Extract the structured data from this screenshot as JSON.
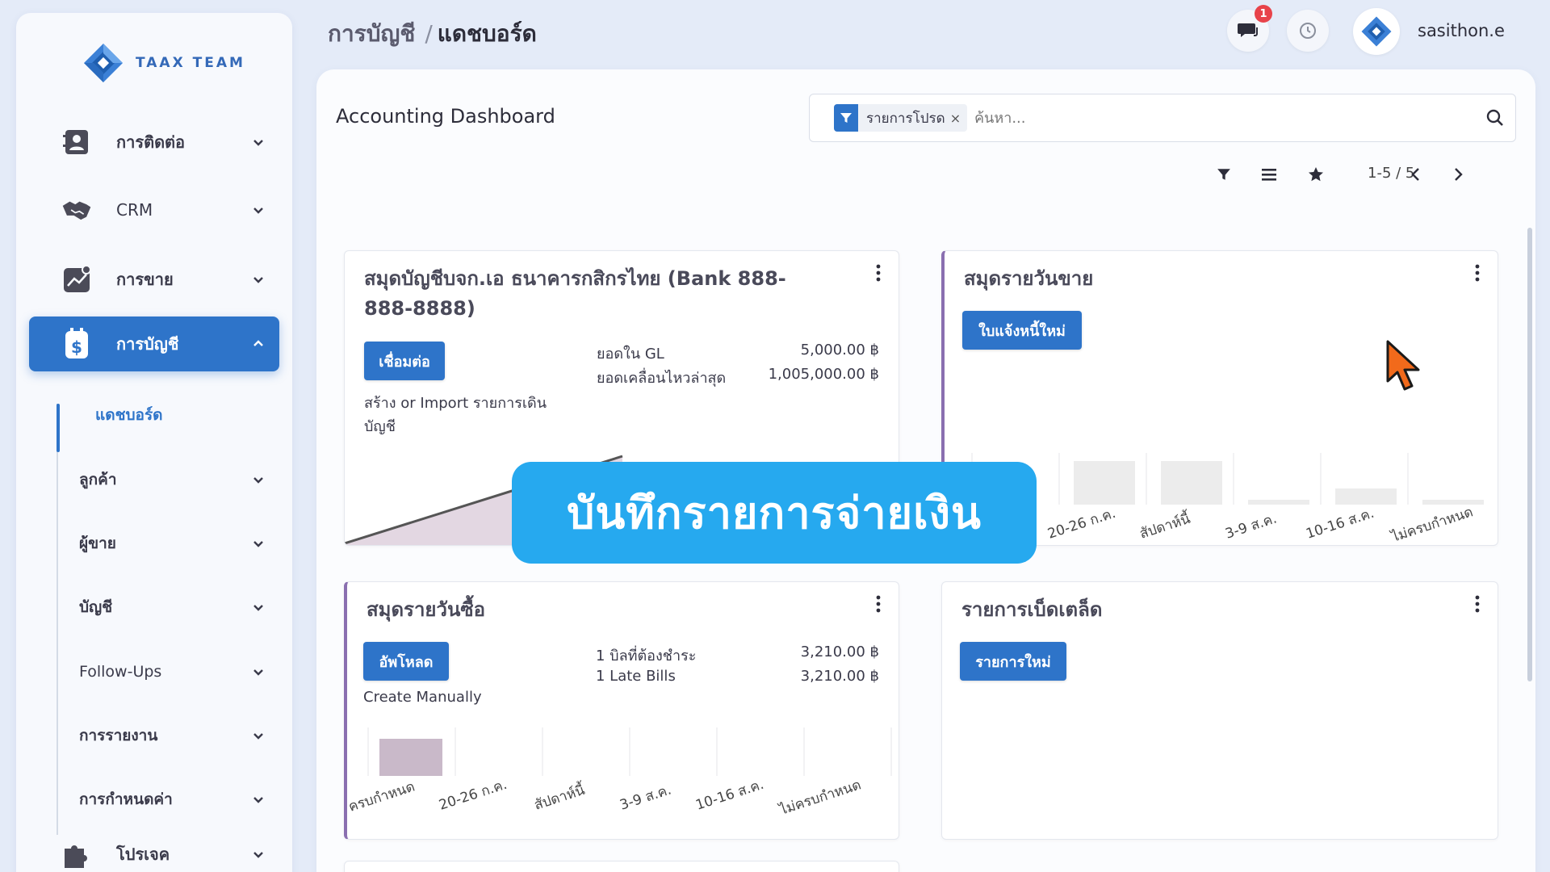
{
  "brand": {
    "name": "TAAX TEAM",
    "color": "#3469b8"
  },
  "sidebar": {
    "items": [
      {
        "label": "การติดต่อ",
        "icon": "contact-card-icon"
      },
      {
        "label": "CRM",
        "icon": "handshake-icon"
      },
      {
        "label": "การขาย",
        "icon": "sales-chart-icon"
      },
      {
        "label": "การบัญชี",
        "icon": "accounting-dollar-icon",
        "active": true
      }
    ],
    "subitems": [
      {
        "label": "แดชบอร์ด",
        "current": true
      },
      {
        "label": "ลูกค้า"
      },
      {
        "label": "ผู้ขาย"
      },
      {
        "label": "บัญชี"
      },
      {
        "label": "Follow-Ups"
      },
      {
        "label": "การรายงาน"
      },
      {
        "label": "การกำหนดค่า"
      }
    ],
    "bottom_item": {
      "label": "โปรเจค",
      "icon": "puzzle-icon"
    }
  },
  "header": {
    "breadcrumb_parent": "การบัญชี",
    "breadcrumb_sep": "/",
    "breadcrumb_current": "แดชบอร์ด",
    "chat_badge": "1",
    "username": "sasithon.e"
  },
  "main": {
    "title": "Accounting Dashboard",
    "search": {
      "facet": "รายการโปรด",
      "facet_close": "×",
      "placeholder": "ค้นหา..."
    },
    "pager": "1-5 / 5"
  },
  "cards": {
    "bank": {
      "title": "สมุดบัญชีบจก.เอ ธนาคารกสิกรไทย (Bank 888-888-8888)",
      "button": "เชื่อมต่อ",
      "note": "สร้าง or Import รายการเดินบัญชี",
      "gl_label": "ยอดใน GL",
      "gl_value": "5,000.00 ฿",
      "last_label": "ยอดเคลื่อนไหวล่าสุด",
      "last_value": "1,005,000.00 ฿"
    },
    "sales": {
      "title": "สมุดรายวันขาย",
      "button": "ใบแจ้งหนี้ใหม่",
      "axis": [
        "20-26 ก.ค.",
        "สัปดาห์นี้",
        "3-9 ส.ค.",
        "10-16 ส.ค.",
        "ไม่ครบกำหนด"
      ]
    },
    "purchase": {
      "title": "สมุดรายวันซื้อ",
      "button": "อัพโหลด",
      "note": "Create Manually",
      "bills_label": "1 บิลที่ต้องชำระ",
      "bills_value": "3,210.00 ฿",
      "late_label": "1 Late Bills",
      "late_value": "3,210.00 ฿",
      "axis": [
        "ครบกำหนด",
        "20-26 ก.ค.",
        "สัปดาห์นี้",
        "3-9 ส.ค.",
        "10-16 ส.ค.",
        "ไม่ครบกำหนด"
      ]
    },
    "misc": {
      "title": "รายการเบ็ดเตล็ด",
      "button": "รายการใหม่"
    }
  },
  "overlay": {
    "text": "บันทึกรายการจ่ายเงิน",
    "color": "#26a9ef"
  },
  "colors": {
    "primary": "#2e74c9",
    "accent": "#8a6fb0",
    "bar": "#c9b9c9",
    "bar_light": "#ececec",
    "badge": "#e8434a"
  }
}
